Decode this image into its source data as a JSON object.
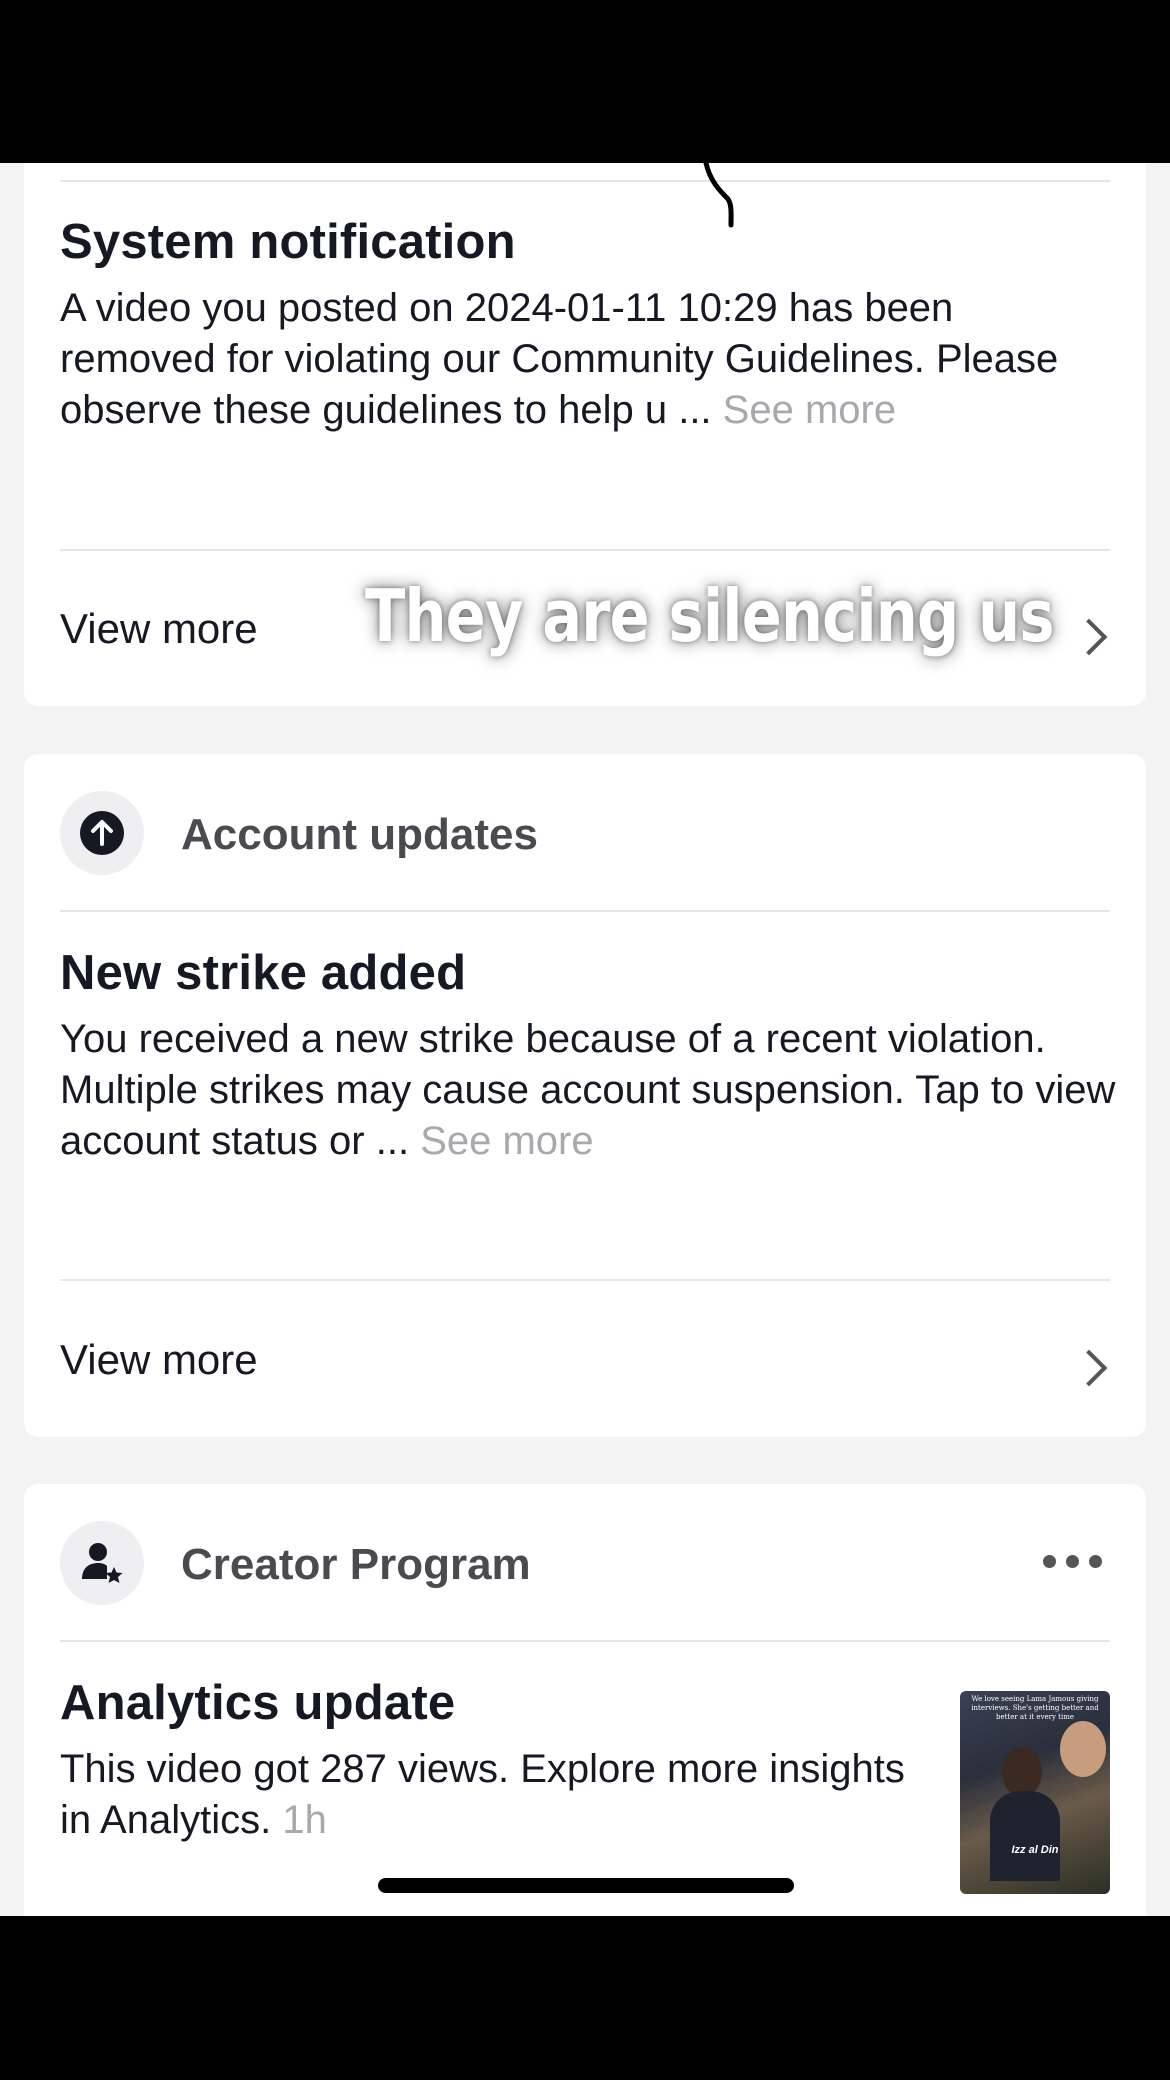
{
  "system_card": {
    "title": "System notification",
    "body": "A video you posted on 2024-01-11 10:29 has been removed for violating our Community Guidelines. Please observe these guidelines to help u ...",
    "see_more": "See more",
    "view_more": "View more"
  },
  "overlay_caption": "They are silencing us",
  "account_card": {
    "section": "Account updates",
    "section_icon": "arrow-up-circle-icon",
    "title": "New strike added",
    "body": "You received a new strike because of a recent violation. Multiple strikes may cause account suspension. Tap to view account status or ...",
    "see_more": "See more",
    "view_more": "View more"
  },
  "creator_card": {
    "section": "Creator Program",
    "section_icon": "creator-star-icon",
    "title": "Analytics update",
    "body": "This video got 287 views. Explore more insights in Analytics.",
    "time": "1h",
    "thumbnail_caption": "We love seeing Lama Jamous giving interviews. She's getting better and better at it every time",
    "thumbnail_tag": "Izz al Din"
  }
}
